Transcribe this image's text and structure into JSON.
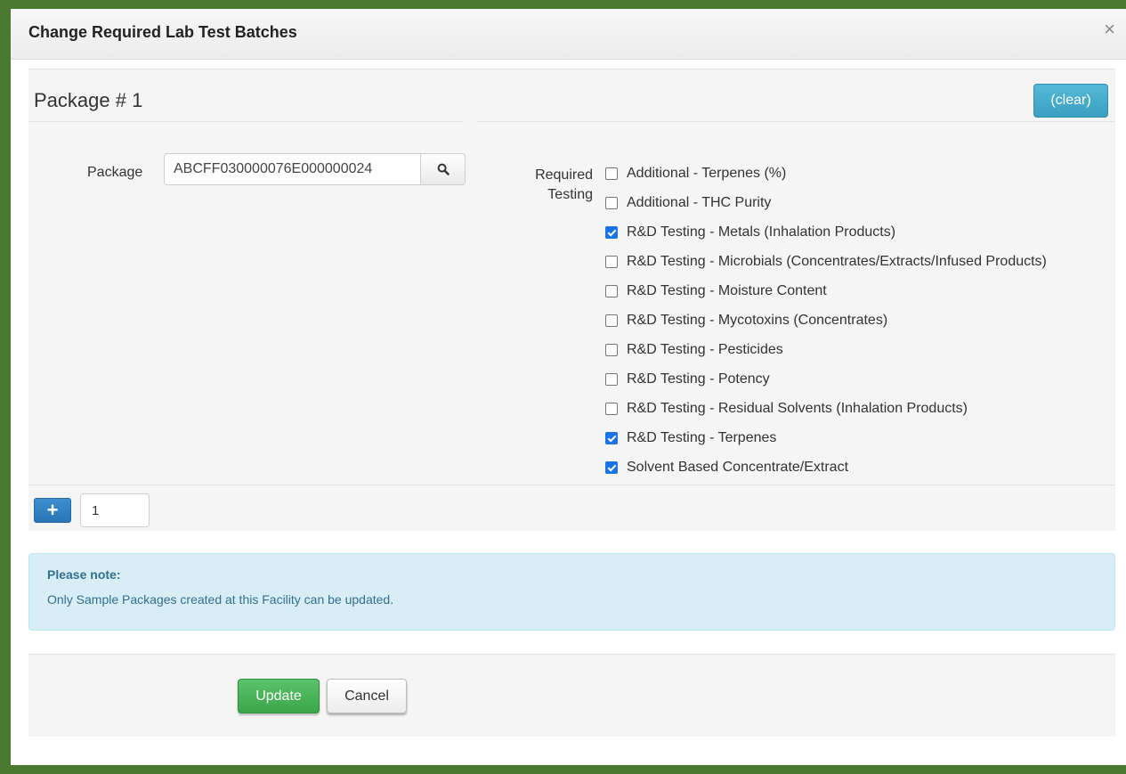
{
  "modal": {
    "title": "Change Required Lab Test Batches",
    "close_glyph": "×"
  },
  "package_section": {
    "title": "Package # 1",
    "clear_label": "(clear)",
    "package_label": "Package",
    "package_value": "ABCFF030000076E000000024",
    "search_icon": "search-icon",
    "required_testing_label_1": "Required",
    "required_testing_label_2": "Testing",
    "tests": [
      {
        "label": "Additional - Terpenes (%)",
        "checked": false
      },
      {
        "label": "Additional - THC Purity",
        "checked": false
      },
      {
        "label": "R&D Testing - Metals (Inhalation Products)",
        "checked": true
      },
      {
        "label": "R&D Testing - Microbials (Concentrates/Extracts/Infused Products)",
        "checked": false
      },
      {
        "label": "R&D Testing - Moisture Content",
        "checked": false
      },
      {
        "label": "R&D Testing - Mycotoxins (Concentrates)",
        "checked": false
      },
      {
        "label": "R&D Testing - Pesticides",
        "checked": false
      },
      {
        "label": "R&D Testing - Potency",
        "checked": false
      },
      {
        "label": "R&D Testing - Residual Solvents (Inhalation Products)",
        "checked": false
      },
      {
        "label": "R&D Testing - Terpenes",
        "checked": true
      },
      {
        "label": "Solvent Based Concentrate/Extract",
        "checked": true
      }
    ]
  },
  "add_row": {
    "add_glyph": "+",
    "count_value": "1"
  },
  "note": {
    "title": "Please note:",
    "text": "Only Sample Packages created at this Facility can be updated."
  },
  "footer": {
    "update_label": "Update",
    "cancel_label": "Cancel"
  },
  "colors": {
    "frame": "#4a7a32",
    "clear_button": "#46acd0",
    "add_button": "#2e7bbd",
    "update_button": "#45b052",
    "checkbox_checked": "#1a73e8",
    "alert_bg": "#d9edf7",
    "alert_text": "#31708f"
  }
}
